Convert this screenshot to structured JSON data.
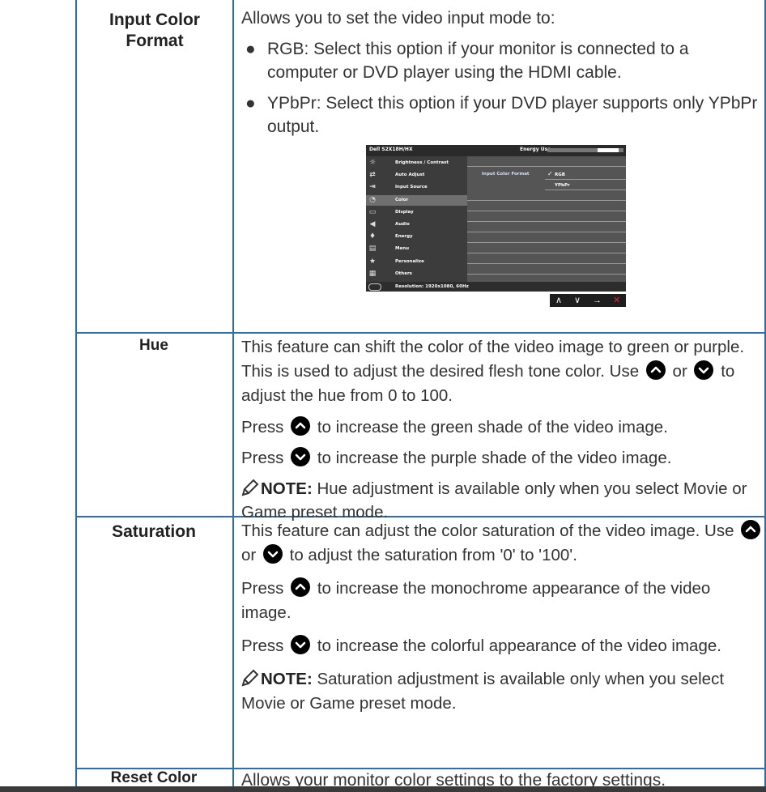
{
  "rows": {
    "input_color_format": {
      "name": "Input Color Format",
      "intro": "Allows you to set the video input mode to:",
      "bullets": [
        "RGB: Select this option if your monitor is connected to a computer or DVD player using the HDMI cable.",
        "YPbPr: Select this option if your DVD player supports only YPbPr output."
      ]
    },
    "hue": {
      "name": "Hue",
      "p1a": "This feature can shift the color of the video image to green or purple. This is used to adjust the desired flesh tone color. Use",
      "p1b": "or",
      "p1c": "to adjust the hue from 0 to 100.",
      "p2a": "Press",
      "p2b": "to increase the green shade of the video image.",
      "p3a": "Press",
      "p3b": "to increase the purple shade of the video image.",
      "note_label": "NOTE:",
      "note_text": " Hue adjustment is available only when you select Movie or Game preset mode."
    },
    "saturation": {
      "name": "Saturation",
      "p1a": "This feature can adjust the color saturation of the video image. Use",
      "p1b": "or",
      "p1c": "to adjust the saturation from '0' to '100'.",
      "p2a": "Press",
      "p2b": "to increase the monochrome appearance of the video image.",
      "p3a": "Press",
      "p3b": "to increase the colorful appearance of the video image.",
      "note_label": "NOTE:",
      "note_text": " Saturation adjustment is available only when you select Movie or Game preset mode."
    },
    "reset_color": {
      "name": "Reset Color",
      "desc": "Allows your monitor color settings to the factory settings."
    }
  },
  "osd": {
    "model": "Dell S2X18H/HX",
    "energy_label": "Energy Use",
    "energy_level": 0.28,
    "menu": [
      {
        "label": "Brightness / Contrast",
        "icon": "brightness-icon",
        "glyph": "☼"
      },
      {
        "label": "Auto Adjust",
        "icon": "auto-adjust-icon",
        "glyph": "⇄"
      },
      {
        "label": "Input Source",
        "icon": "input-source-icon",
        "glyph": "⇥"
      },
      {
        "label": "Color",
        "icon": "color-icon",
        "glyph": "◔"
      },
      {
        "label": "Display",
        "icon": "display-icon",
        "glyph": "▭"
      },
      {
        "label": "Audio",
        "icon": "audio-icon",
        "glyph": "◀"
      },
      {
        "label": "Energy",
        "icon": "energy-icon",
        "glyph": "♦"
      },
      {
        "label": "Menu",
        "icon": "menu-icon",
        "glyph": "▤"
      },
      {
        "label": "Personalize",
        "icon": "personalize-icon",
        "glyph": "★"
      },
      {
        "label": "Others",
        "icon": "others-icon",
        "glyph": "▦"
      }
    ],
    "selected_item": "Color",
    "right_label": "Input Color Format",
    "check": "✓",
    "option_rgb": "RGB",
    "option_ypbpr": "YPbPr",
    "resolution": "Resolution: 1920x1080, 60Hz",
    "nav": {
      "up": "∧",
      "down": "∨",
      "enter": "→",
      "exit": "✕"
    }
  },
  "colors": {
    "border": "#2e6ea6",
    "nav_exit": "#e0282e",
    "osd_bg": "#3c3c3c"
  }
}
